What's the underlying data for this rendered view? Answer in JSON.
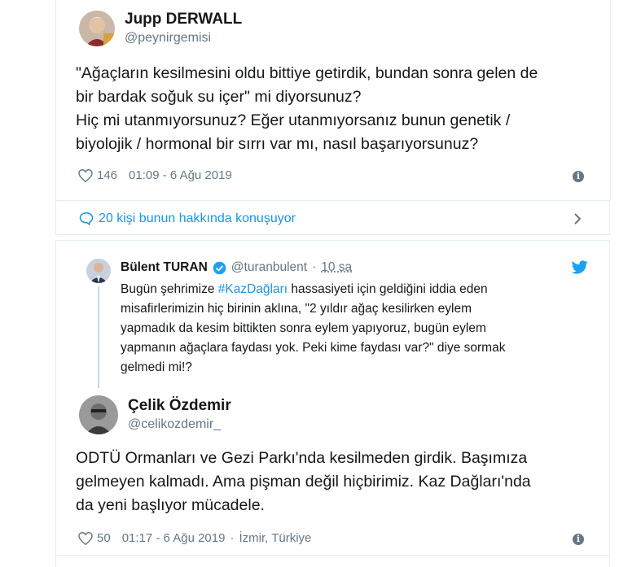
{
  "tweet1": {
    "author_name": "Jupp DERWALL",
    "author_handle": "@peynirgemisi",
    "text": "\"Ağaçların kesilmesini oldu bittiye getirdik, bundan sonra gelen de\nbir bardak soğuk su içer\" mi diyorsunuz?\nHiç mi utanmıyorsunuz? Eğer utanmıyorsanız bunun genetik /\nbiyolojik / hormonal bir sırrı var mı, nasıl başarıyorsunuz?",
    "likes": "146",
    "timestamp": "01:09 - 6 Ağu 2019"
  },
  "conversation": {
    "label": "20 kişi bunun hakkında konuşuyor"
  },
  "quoted": {
    "author_name": "Bülent TURAN",
    "author_handle": "@turanbulent",
    "time_ago": "10 sa",
    "text_before": "Bugün şehrimize ",
    "hashtag": "#KazDağları",
    "text_after": " hassasiyeti için geldiğini iddia eden\nmisafirlerimizin hiç birinin aklına, \"2 yıldır ağaç kesilirken eylem\nyapmadık da kesim bittikten sonra eylem yapıyoruz, bugün eylem\nyapmanın ağaçlara faydası yok. Peki kime faydası var?\" diye sormak\ngelmedi mi!?"
  },
  "tweet2": {
    "author_name": "Çelik Özdemir",
    "author_handle": "@celikozdemir_",
    "text": "ODTÜ Ormanları ve Gezi Parkı'nda kesilmeden girdik. Başımıza\ngelmeyen kalmadı. Ama pişman değil hiçbirimiz. Kaz Dağları'nda\nda yeni başlıyor mücadele.",
    "likes": "50",
    "timestamp": "01:17 - 6 Ağu 2019",
    "separator": "·",
    "location": "İzmir, Türkiye"
  },
  "colors": {
    "link": "#1b95e0",
    "verified": "#1da1f2",
    "muted": "#657786",
    "border": "#e6ecf0"
  },
  "icons": [
    "heart-icon",
    "info-icon",
    "speech-bubble-icon",
    "chevron-right-icon",
    "verified-badge-icon",
    "twitter-bird-icon"
  ]
}
